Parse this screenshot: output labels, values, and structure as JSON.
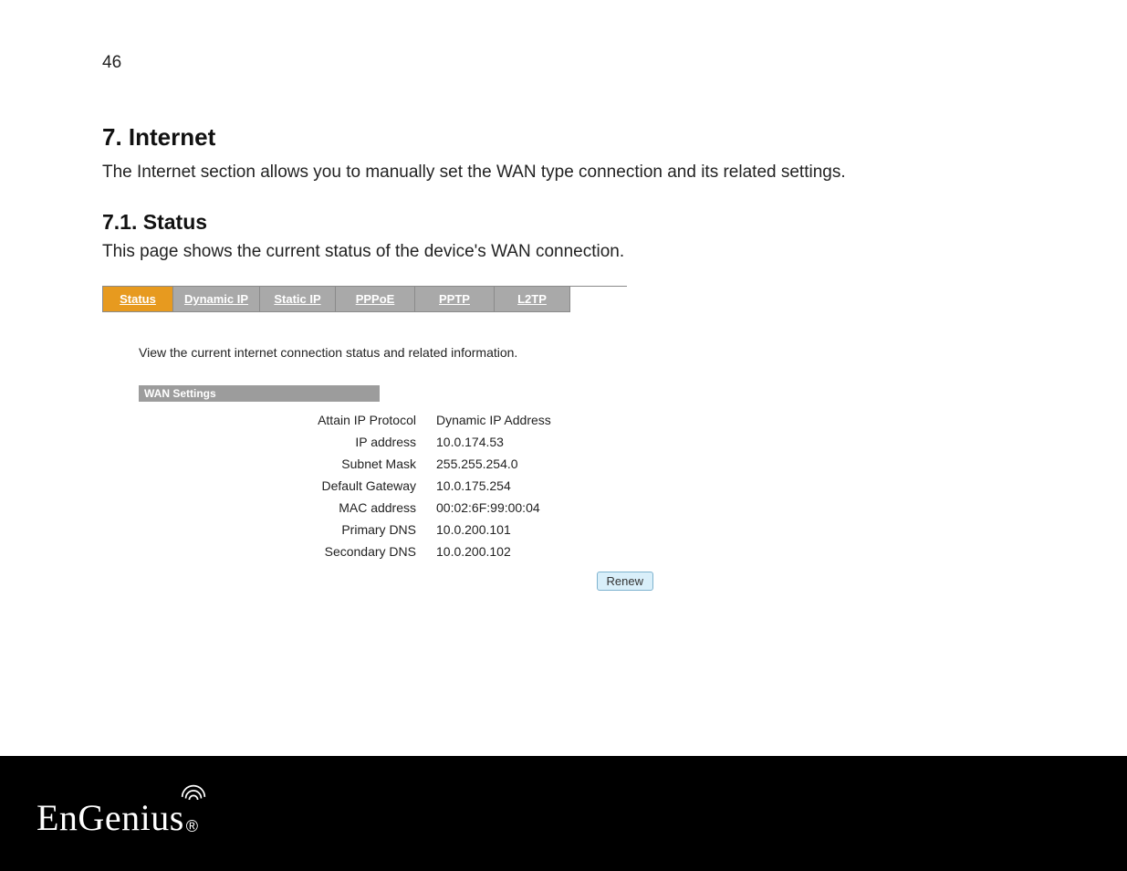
{
  "page_number": "46",
  "heading": "7. Internet",
  "intro_text": "The Internet section allows you to manually set the WAN type connection and its related settings.",
  "sub_heading": "7.1. Status",
  "sub_intro_text": "This page shows the current status of the device's WAN connection.",
  "tabs": {
    "status": "Status",
    "dynamic_ip": "Dynamic IP",
    "static_ip": "Static IP",
    "pppoe": "PPPoE",
    "pptp": "PPTP",
    "l2tp": "L2TP"
  },
  "screenshot": {
    "description": "View the current internet connection status and related information.",
    "section_title": "WAN Settings",
    "rows": {
      "attain_ip_protocol": {
        "label": "Attain IP Protocol",
        "value": "Dynamic IP Address"
      },
      "ip_address": {
        "label": "IP address",
        "value": "10.0.174.53"
      },
      "subnet_mask": {
        "label": "Subnet Mask",
        "value": "255.255.254.0"
      },
      "default_gateway": {
        "label": "Default Gateway",
        "value": "10.0.175.254"
      },
      "mac_address": {
        "label": "MAC address",
        "value": "00:02:6F:99:00:04"
      },
      "primary_dns": {
        "label": "Primary DNS",
        "value": "10.0.200.101"
      },
      "secondary_dns": {
        "label": "Secondary DNS",
        "value": "10.0.200.102"
      }
    },
    "renew_button": "Renew"
  },
  "footer": {
    "brand": "EnGenius",
    "registered": "®"
  }
}
